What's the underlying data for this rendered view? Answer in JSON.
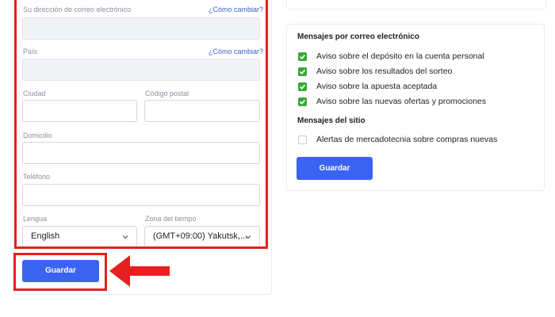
{
  "profile_form": {
    "email": {
      "label": "Su dirección de correo electrónico",
      "change_link": "¿Cómo cambiar?",
      "value": ""
    },
    "country": {
      "label": "País",
      "change_link": "¿Cómo cambiar?",
      "value": ""
    },
    "city": {
      "label": "Ciudad",
      "value": ""
    },
    "postal_code": {
      "label": "Código postal",
      "value": ""
    },
    "address": {
      "label": "Domicilio",
      "value": ""
    },
    "phone": {
      "label": "Teléfono",
      "value": ""
    },
    "language": {
      "label": "Lengua",
      "value": "English"
    },
    "timezone": {
      "label": "Zona del tiempo",
      "value": "(GMT+09:00) Yakutsk,..."
    },
    "save_label": "Guardar"
  },
  "notifications": {
    "email_section_title": "Mensajes por correo electrónico",
    "email_options": [
      {
        "label": "Aviso sobre el depósito en la cuenta personal",
        "checked": true
      },
      {
        "label": "Aviso sobre los resultados del sorteo",
        "checked": true
      },
      {
        "label": "Aviso sobre la apuesta aceptada",
        "checked": true
      },
      {
        "label": "Aviso sobre las nuevas ofertas y promociones",
        "checked": true
      }
    ],
    "site_section_title": "Mensajes del sitio",
    "site_options": [
      {
        "label": "Alertas de mercadotecnia sobre compras nuevas",
        "checked": false
      }
    ],
    "save_label": "Guardar"
  },
  "colors": {
    "highlight": "#e62020",
    "primary_button": "#3b63f2",
    "checkbox_checked": "#3aa83a",
    "link": "#3a63c8"
  },
  "icons": {
    "arrow": "red-left-arrow-icon",
    "checkbox": "checkmark-icon",
    "dropdown": "chevron-down-icon"
  }
}
